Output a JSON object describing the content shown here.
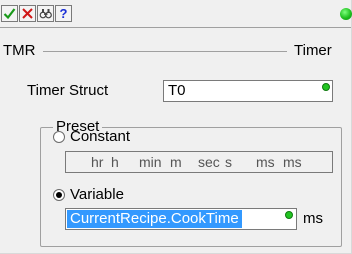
{
  "toolbar": {
    "buttons": [
      {
        "icon": "checkmark-icon",
        "color": "#1a9a1a"
      },
      {
        "icon": "close-x-icon",
        "color": "#d01818"
      },
      {
        "icon": "search-binoculars-icon",
        "color": "#444444"
      },
      {
        "icon": "help-icon",
        "label": "?",
        "color": "#1a2fd6"
      }
    ],
    "status_color": "#1fbf1f"
  },
  "header": {
    "left_label": "TMR",
    "right_label": "Timer"
  },
  "timer_struct": {
    "label": "Timer Struct",
    "value": "T0"
  },
  "preset": {
    "group_title": "Preset",
    "constant_label": "Constant",
    "constant_selected": false,
    "duration_fields": [
      {
        "value": "hr",
        "unit": "h"
      },
      {
        "value": "min",
        "unit": "m"
      },
      {
        "value": "sec",
        "unit": "s"
      },
      {
        "value": "ms",
        "unit": "ms"
      }
    ],
    "variable_label": "Variable",
    "variable_selected": true,
    "variable_value": "CurrentRecipe.CookTime",
    "variable_unit": "ms"
  }
}
